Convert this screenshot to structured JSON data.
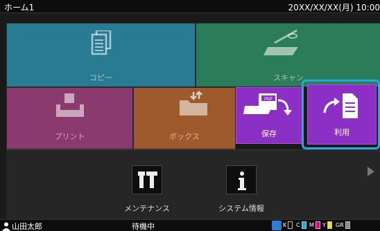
{
  "header": {
    "title": "ホーム1",
    "datetime": "20XX/XX/XX(月) 10:00"
  },
  "tiles": {
    "copy": {
      "label": "コピー",
      "color": "#297a93"
    },
    "scan": {
      "label": "スキャン",
      "color": "#2b7c58"
    },
    "print": {
      "label": "プリント",
      "color": "#8a3a6e"
    },
    "box": {
      "label": "ボックス",
      "color": "#9e5a2c"
    }
  },
  "popup": {
    "save": {
      "label": "保存",
      "pdf_badge": "PDF"
    },
    "use": {
      "label": "利用"
    },
    "accent": "#8b2fc5",
    "selection_ring": "#2aa6e0"
  },
  "bottom": {
    "maintenance": {
      "label": "メンテナンス",
      "icon": "tools-icon"
    },
    "sysinfo": {
      "label": "システム情報",
      "icon": "info-icon"
    }
  },
  "status": {
    "user": "山田太郎",
    "state": "待機中",
    "inks": [
      {
        "name": "K",
        "color": "#111111"
      },
      {
        "name": "C",
        "color": "#27a9e1"
      },
      {
        "name": "M",
        "color": "#e5007e"
      },
      {
        "name": "Y",
        "color": "#ffe100"
      },
      {
        "name": "GR",
        "color": "#888888"
      }
    ]
  }
}
